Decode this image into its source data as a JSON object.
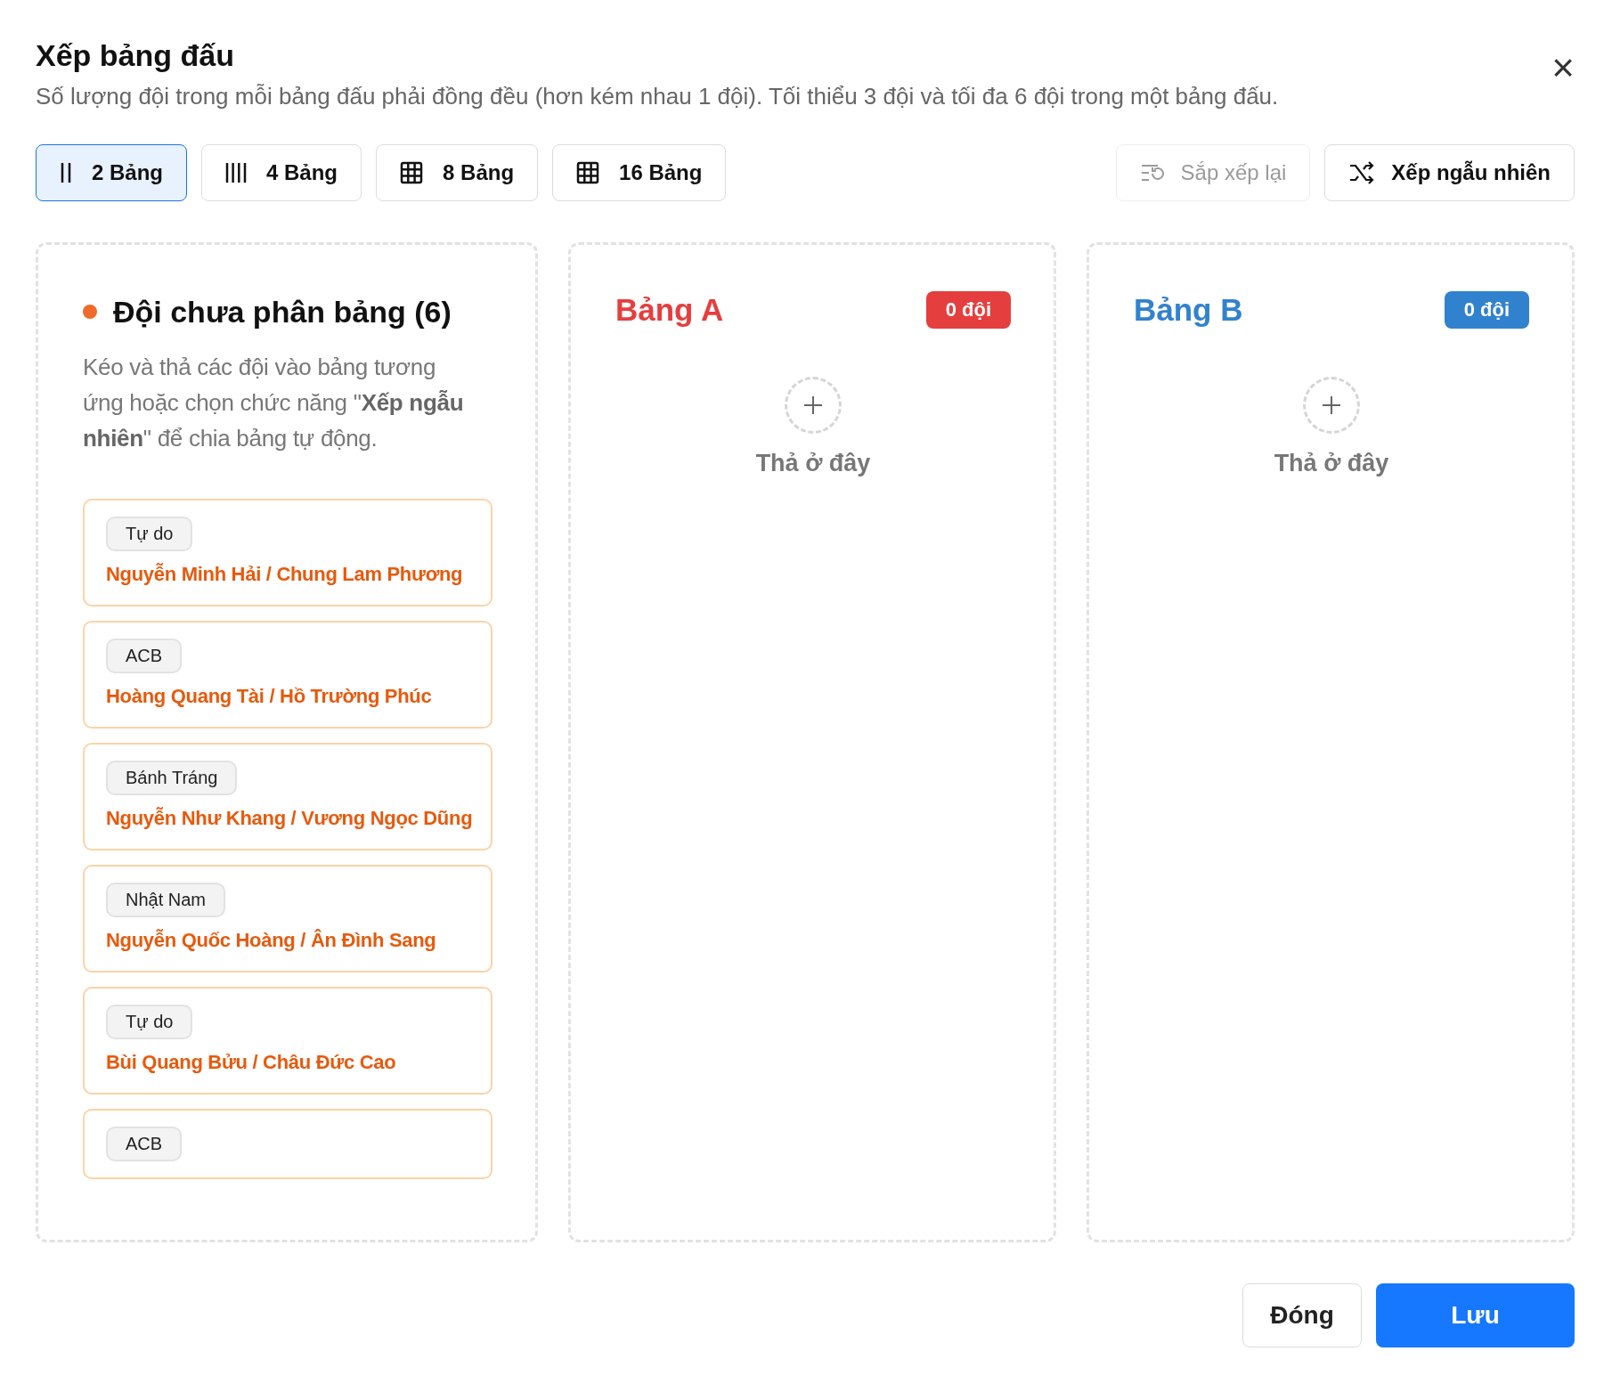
{
  "dialog": {
    "title": "Xếp bảng đấu",
    "subtitle": "Số lượng đội trong mỗi bảng đấu phải đồng đều (hơn kém nhau 1 đội). Tối thiểu 3 đội và tối đa 6 đội trong một bảng đấu.",
    "close": "×"
  },
  "board_options": [
    {
      "label": "2 Bảng",
      "kind": "bars2",
      "selected": true
    },
    {
      "label": "4 Bảng",
      "kind": "bars4",
      "selected": false
    },
    {
      "label": "8 Bảng",
      "kind": "grid",
      "selected": false
    },
    {
      "label": "16 Bảng",
      "kind": "grid",
      "selected": false
    }
  ],
  "actions": [
    {
      "label": "Sắp xếp lại",
      "kind": "reset",
      "disabled": true
    },
    {
      "label": "Xếp ngẫu nhiên",
      "kind": "shuffle",
      "disabled": false
    }
  ],
  "unassigned": {
    "title": "Đội chưa phân bảng (6)",
    "color": "#f06a2a",
    "description": "Kéo và thả các đội vào bảng tương ứng hoặc chọn chức năng \"**Xếp ngẫu nhiên**\" để chia bảng tự động.",
    "teams": [
      {
        "club": "Tự do",
        "players": "Nguyễn Minh Hải / Chung Lam Phương"
      },
      {
        "club": "ACB",
        "players": "Hoàng Quang Tài / Hồ Trường Phúc"
      },
      {
        "club": "Bánh Tráng",
        "players": "Nguyễn Như Khang / Vương Ngọc Dũng"
      },
      {
        "club": "Nhật Nam",
        "players": "Nguyễn Quốc Hoàng / Ân Đình Sang"
      },
      {
        "club": "Tự do",
        "players": "Bùi Quang Bửu / Châu Đức Cao"
      },
      {
        "club": "ACB"
      }
    ]
  },
  "groups": [
    {
      "name": "Bảng A",
      "count": "0 đội",
      "color": "#e53e3e",
      "drop_hint": "Thả ở đây"
    },
    {
      "name": "Bảng B",
      "count": "0 đội",
      "color": "#3182ce",
      "drop_hint": "Thả ở đây"
    }
  ],
  "footer": {
    "buttons": [
      {
        "label": "Đóng",
        "kind": "secondary"
      },
      {
        "label": "Lưu",
        "kind": "primary"
      }
    ]
  }
}
